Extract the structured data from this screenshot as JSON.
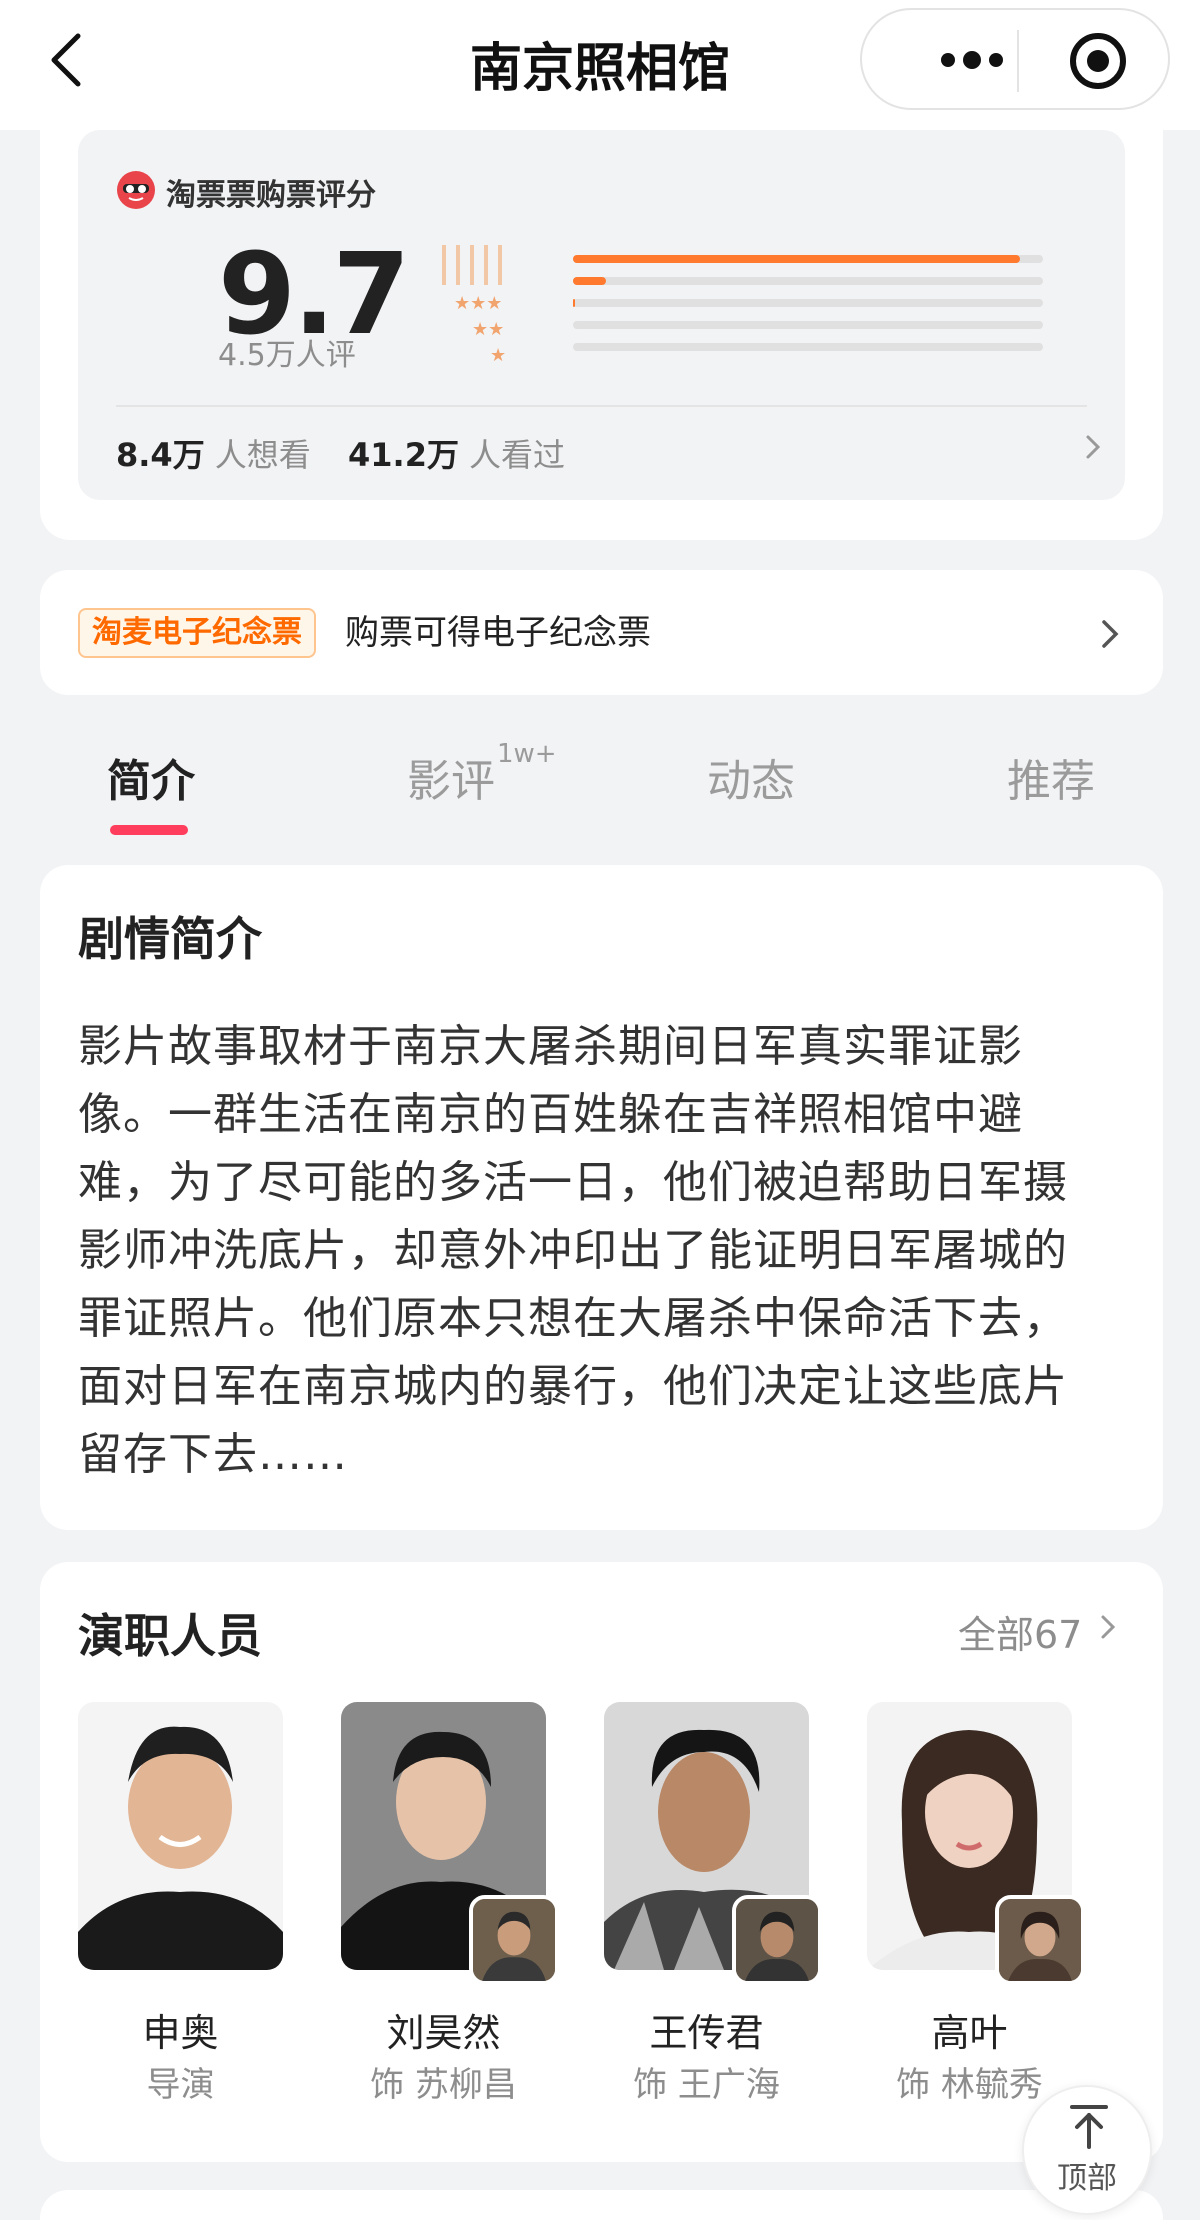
{
  "header": {
    "title": "南京照相馆",
    "back_icon": "chevron-left-icon",
    "more_icon": "more-dots-icon",
    "close_icon": "target-circle-icon"
  },
  "rating": {
    "source_label": "淘票票购票评分",
    "score": "9.7",
    "count": "4.5万人评",
    "distribution": [
      0.95,
      0.07,
      0.005,
      0,
      0
    ],
    "accent_color": "#ff7a2f",
    "want_count": "8.4万",
    "want_label": "人想看",
    "seen_count": "41.2万",
    "seen_label": "人看过"
  },
  "souvenir": {
    "badge": "淘麦电子纪念票",
    "text": "购票可得电子纪念票"
  },
  "tabs": [
    {
      "label": "简介",
      "sup": "",
      "active": true
    },
    {
      "label": "影评",
      "sup": "1w+",
      "active": false
    },
    {
      "label": "动态",
      "sup": "",
      "active": false
    },
    {
      "label": "推荐",
      "sup": "",
      "active": false
    }
  ],
  "synopsis": {
    "title": "剧情简介",
    "lines": [
      "影片故事取材于南京大屠杀期间日军真实罪证影",
      "像。一群生活在南京的百姓躲在吉祥照相馆中避",
      "难，为了尽可能的多活一日，他们被迫帮助日军摄",
      "影师冲洗底片，却意外冲印出了能证明日军屠城的",
      "罪证照片。他们原本只想在大屠杀中保命活下去，",
      "面对日军在南京城内的暴行，他们决定让这些底片",
      "留存下去……"
    ]
  },
  "cast": {
    "title": "演职人员",
    "all_label": "全部67",
    "members": [
      {
        "name": "申奥",
        "role": "导演"
      },
      {
        "name": "刘昊然",
        "role": "饰 苏柳昌"
      },
      {
        "name": "王传君",
        "role": "饰 王广海"
      },
      {
        "name": "高叶",
        "role": "饰 林毓秀"
      }
    ]
  },
  "top_button": {
    "label": "顶部"
  }
}
